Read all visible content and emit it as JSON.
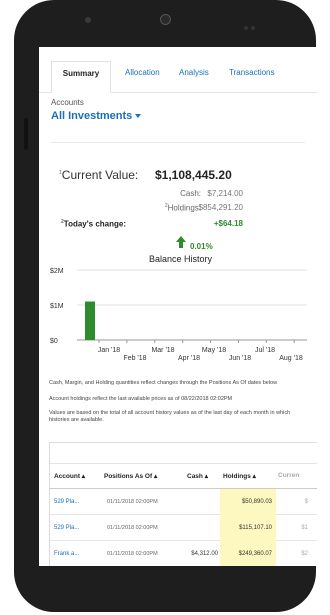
{
  "tabs": [
    {
      "label": "Summary"
    },
    {
      "label": "Allocation"
    },
    {
      "label": "Analysis"
    },
    {
      "label": "Transactions"
    }
  ],
  "accounts": {
    "label": "Accounts",
    "selected": "All Investments"
  },
  "summary": {
    "current_value_label": "Current Value:",
    "current_value": "$1,108,445.20",
    "cash_label": "Cash:",
    "cash_value": "$7,214.00",
    "holdings_label": "Holdings:",
    "holdings_value": "$854,291.20",
    "todays_change_label": "Today's change:",
    "todays_change_value": "+$64.18",
    "todays_change_pct": "0.01%",
    "footnote_1": "1",
    "footnote_2": "2"
  },
  "chart_data": {
    "type": "bar",
    "title": "Balance History",
    "y_ticks": [
      "$2M",
      "$1M",
      "$0"
    ],
    "ylim": [
      0,
      2000000
    ],
    "x_ticks_top": [
      "Jan '18",
      "Mar '18",
      "May '18",
      "Jul '18"
    ],
    "x_ticks_bottom": [
      "Feb '18",
      "Apr '18",
      "Jun '18",
      "Aug '18"
    ],
    "categories": [
      "Jan '18",
      "Feb '18",
      "Mar '18",
      "Apr '18",
      "May '18",
      "Jun '18",
      "Jul '18",
      "Aug '18"
    ],
    "values": [
      1100000,
      0,
      0,
      0,
      0,
      0,
      0,
      0
    ],
    "bar_color": "#2e8b2e"
  },
  "disclaimer": {
    "line1": "Cash, Margin, and Holding quantities reflect changes through the Positions As Of dates below",
    "line2": "Account holdings reflect the last available prices as of 08/22/2018 02:02PM",
    "line3": "Values are based on the total of all account history values as of the last day of each month in which histories are available."
  },
  "table": {
    "columns": [
      "Account",
      "Positions As Of",
      "Cash",
      "Holdings",
      "Curren"
    ],
    "rows": [
      {
        "account": "529 Pla...",
        "as_of": "01/11/2018 02:00PM",
        "cash": "",
        "holdings": "$50,890.03",
        "current": "$"
      },
      {
        "account": "529 Pla...",
        "as_of": "01/11/2018 02:00PM",
        "cash": "",
        "holdings": "$115,107.10",
        "current": "$1"
      },
      {
        "account": "Frank a...",
        "as_of": "01/11/2018 02:00PM",
        "cash": "$4,312.00",
        "holdings": "$249,360.07",
        "current": "$2"
      }
    ]
  },
  "colors": {
    "accent": "#1a6fb8",
    "positive": "#2e8b2e",
    "highlight": "#fdf7c0"
  }
}
